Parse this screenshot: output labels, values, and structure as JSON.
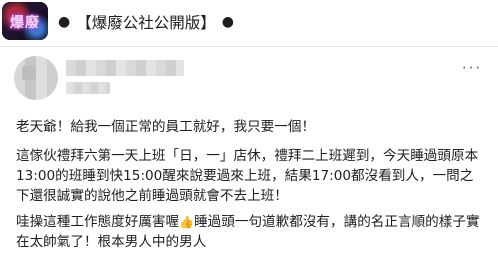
{
  "group": {
    "avatar_text": "爆廢",
    "title_bullet": "●",
    "title": "【爆廢公社公開版】",
    "title_bullet_end": "●"
  },
  "post": {
    "more_label": "···",
    "paragraphs": [
      "老天爺！給我一個正常的員工就好，我只要一個！",
      "這傢伙禮拜六第一天上班「日，一」店休，禮拜二上班遲到，今天睡過頭原本13:00的班睡到快15:00醒來說要過來上班，結果17:00都沒看到人，一問之下還很誠實的說他之前睡過頭就會不去上班！"
    ],
    "last_paragraph": {
      "before_icon": "哇操這種工作態度好厲害喔",
      "icon": "thumbs-up-icon",
      "icon_glyph": "👍",
      "after_icon": "睡過頭一句道歉都沒有，講的名正言順的樣子實在太帥氣了！根本男人中的男人"
    }
  }
}
